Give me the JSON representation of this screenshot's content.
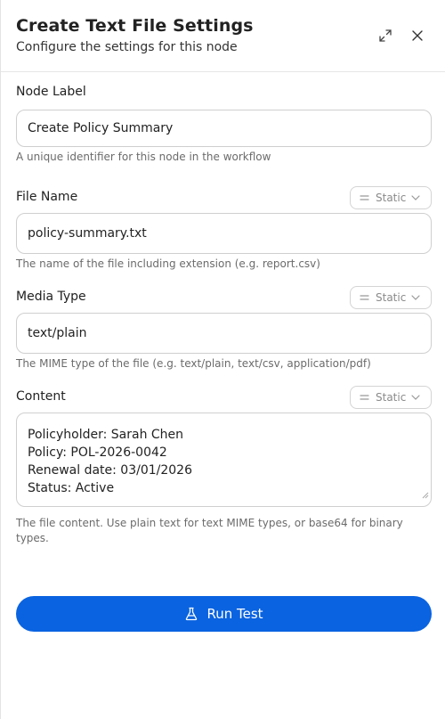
{
  "header": {
    "title": "Create Text File Settings",
    "subtitle": "Configure the settings for this node",
    "expand_icon": "expand-icon",
    "close_icon": "close-icon"
  },
  "fields": {
    "node_label": {
      "label": "Node Label",
      "value": "Create Policy Summary",
      "help": "A unique identifier for this node in the workflow"
    },
    "file_name": {
      "label": "File Name",
      "mode": "Static",
      "value": "policy-summary.txt",
      "help": "The name of the file including extension (e.g. report.csv)"
    },
    "media_type": {
      "label": "Media Type",
      "mode": "Static",
      "value": "text/plain",
      "help": "The MIME type of the file (e.g. text/plain, text/csv, application/pdf)"
    },
    "content": {
      "label": "Content",
      "mode": "Static",
      "lines": [
        "Policyholder: Sarah Chen",
        "Policy: POL-2026-0042",
        "Renewal date: 03/01/2026",
        "Status: Active"
      ],
      "help": "The file content. Use plain text for text MIME types, or base64 for binary types."
    }
  },
  "actions": {
    "run_test_label": "Run Test",
    "run_test_icon": "flask-icon"
  },
  "colors": {
    "accent": "#0a63e0",
    "border": "#cfcfcf",
    "help_text": "#6b6b6b"
  }
}
